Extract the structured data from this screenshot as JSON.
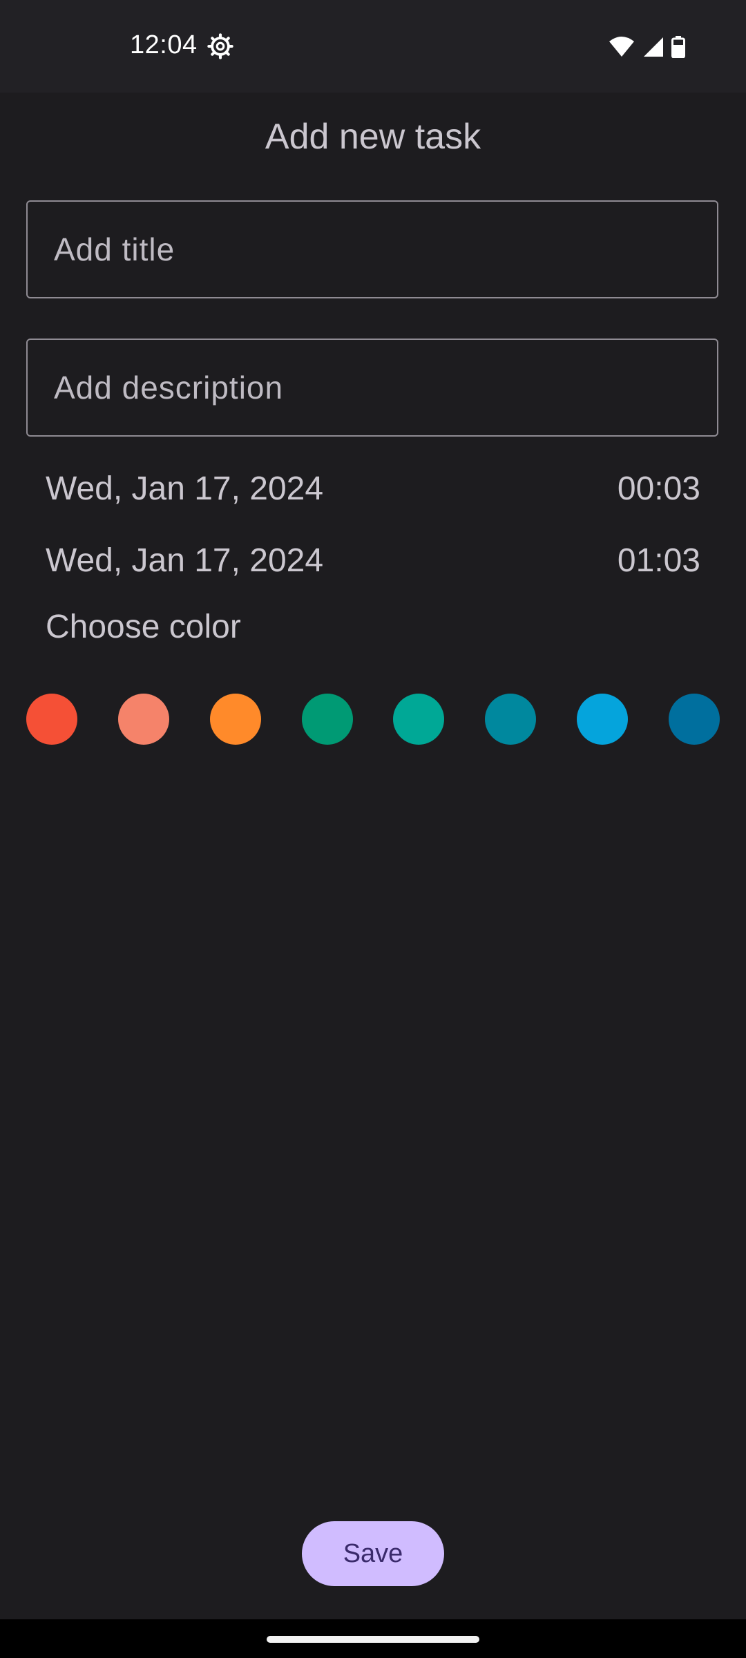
{
  "status_bar": {
    "time": "12:04",
    "icons": [
      "settings-gear-icon",
      "wifi-icon",
      "signal-icon",
      "battery-icon"
    ]
  },
  "page": {
    "title": "Add new task"
  },
  "form": {
    "title_placeholder": "Add title",
    "description_placeholder": "Add description",
    "start": {
      "date": "Wed, Jan 17, 2024",
      "time": "00:03"
    },
    "end": {
      "date": "Wed, Jan 17, 2024",
      "time": "01:03"
    },
    "choose_color_label": "Choose color",
    "colors": [
      "#f55036",
      "#f5836a",
      "#ff8a2a",
      "#009a74",
      "#00a896",
      "#00889e",
      "#05a4dc",
      "#006f9e"
    ]
  },
  "actions": {
    "save_label": "Save"
  },
  "theme": {
    "background": "#1d1c1f",
    "accent": "#d0bcff"
  }
}
